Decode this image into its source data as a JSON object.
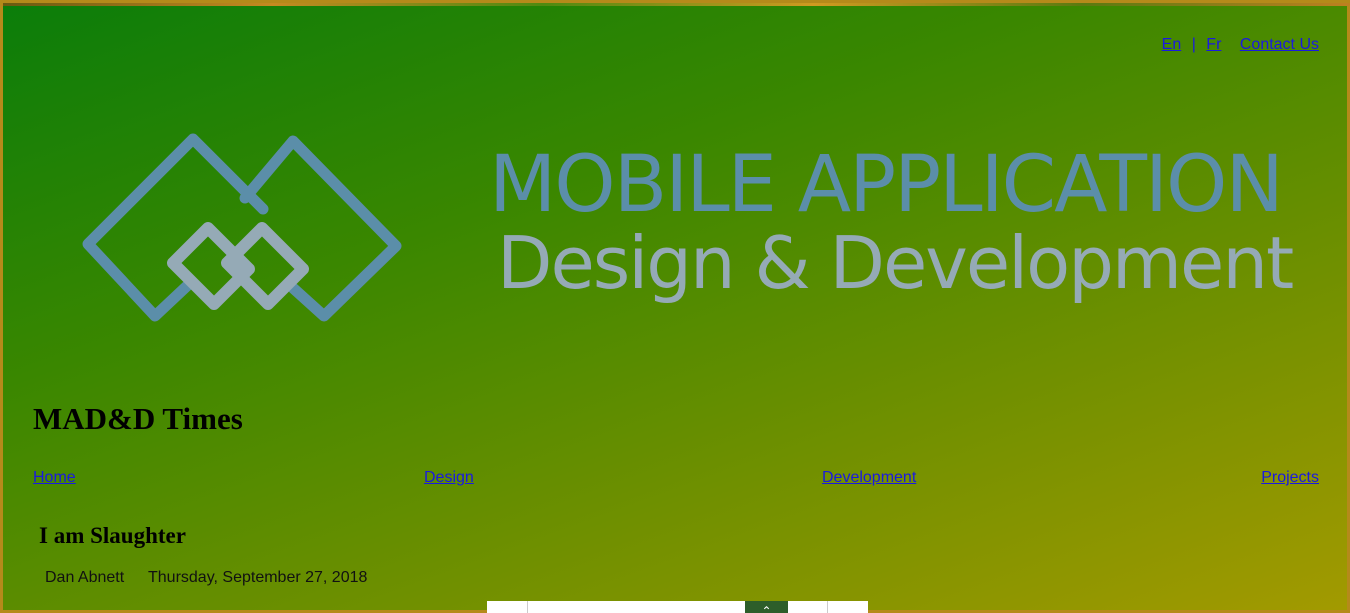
{
  "header": {
    "lang_en": "En",
    "lang_sep": "|",
    "lang_fr": "Fr",
    "contact": "Contact Us"
  },
  "banner": {
    "title": "MOBILE APPLICATION",
    "subtitle": "Design & Development",
    "title_color": "#5b8ea9",
    "subtitle_color": "#95aab6",
    "logo_icon": "linked-diamonds-logo"
  },
  "site": {
    "name": "MAD&D Times"
  },
  "nav": {
    "items": [
      {
        "label": "Home"
      },
      {
        "label": "Design"
      },
      {
        "label": "Development"
      },
      {
        "label": "Projects"
      }
    ]
  },
  "article": {
    "title": "I am Slaughter",
    "author": "Dan Abnett",
    "date": "Thursday, September 27, 2018"
  },
  "colors": {
    "link": "#1a1ae0",
    "bg_start": "#0a7d0a",
    "bg_end": "#a39a00"
  }
}
